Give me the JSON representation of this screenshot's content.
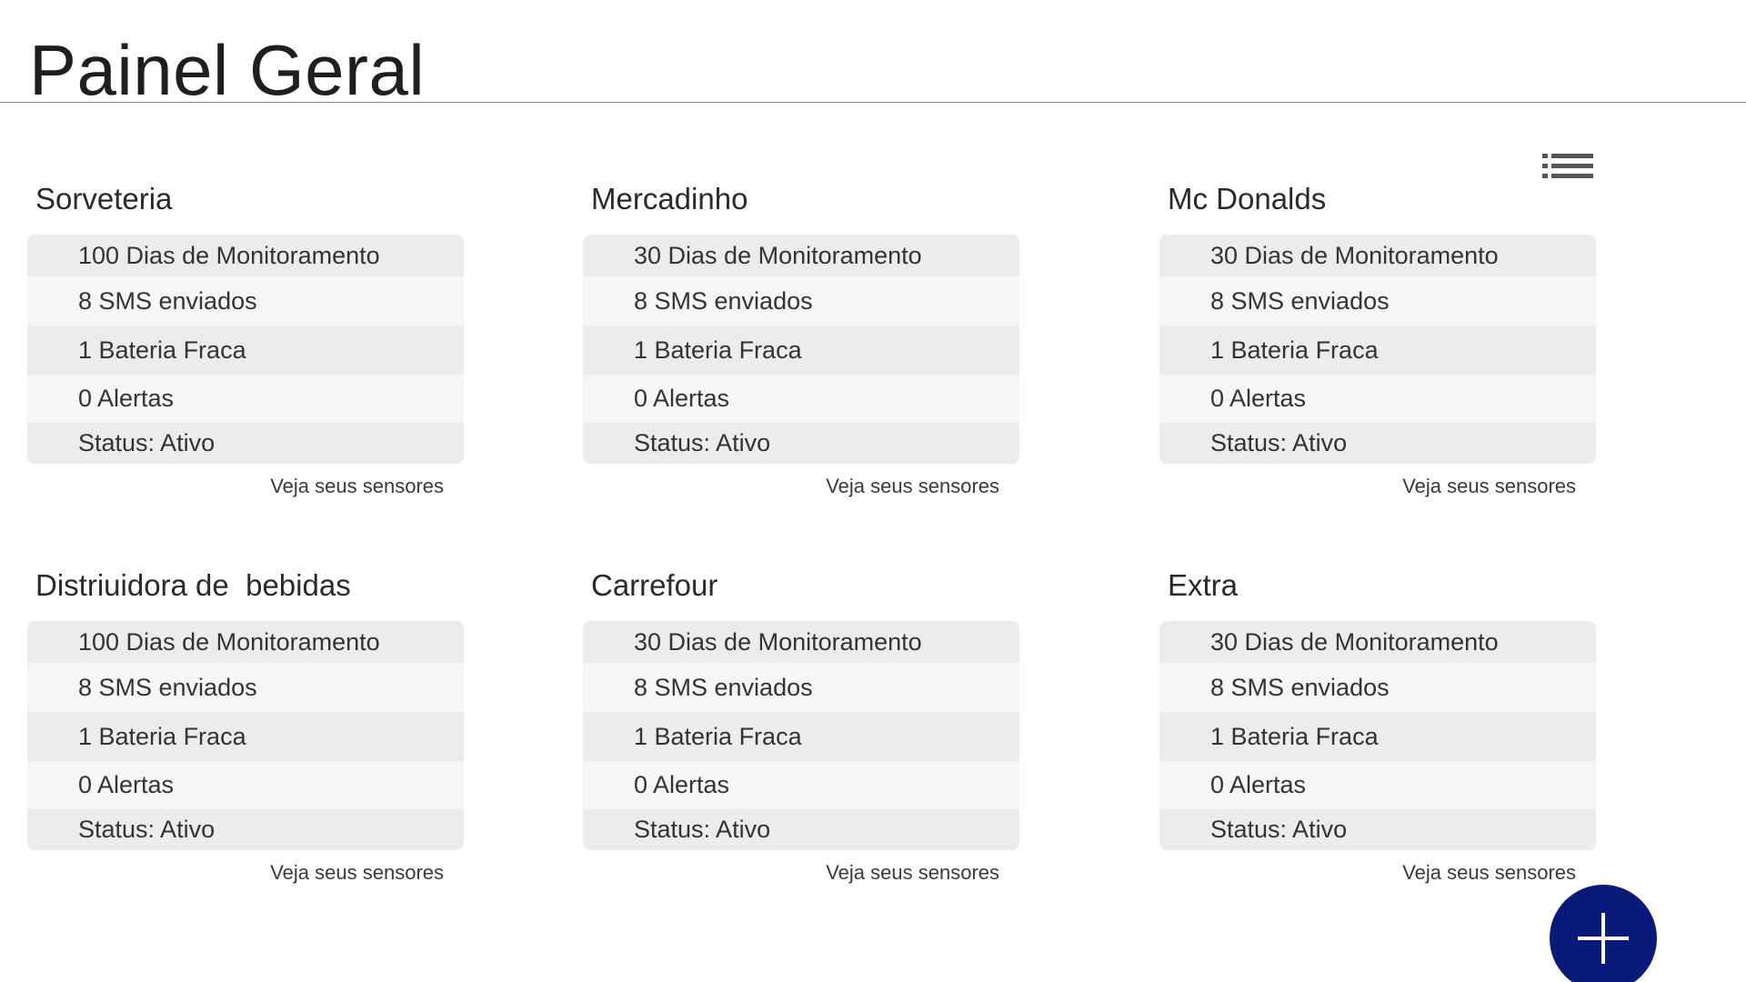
{
  "header": {
    "title": "Painel Geral",
    "menu_icon": "list-menu-icon"
  },
  "cards": [
    {
      "title": "Sorveteria",
      "stats": [
        "100 Dias de Monitoramento",
        "8 SMS enviados",
        "1 Bateria Fraca",
        "0 Alertas",
        "Status: Ativo"
      ],
      "link": "Veja seus sensores"
    },
    {
      "title": "Mercadinho",
      "stats": [
        "30 Dias de Monitoramento",
        "8 SMS enviados",
        "1 Bateria Fraca",
        "0 Alertas",
        "Status: Ativo"
      ],
      "link": "Veja seus sensores"
    },
    {
      "title": "Mc Donalds",
      "stats": [
        "30 Dias de Monitoramento",
        "8 SMS enviados",
        "1 Bateria Fraca",
        "0 Alertas",
        "Status: Ativo"
      ],
      "link": "Veja seus sensores"
    },
    {
      "title": "Distriuidora de  bebidas",
      "stats": [
        "100 Dias de Monitoramento",
        "8 SMS enviados",
        "1 Bateria Fraca",
        "0 Alertas",
        "Status: Ativo"
      ],
      "link": "Veja seus sensores"
    },
    {
      "title": "Carrefour",
      "stats": [
        "30 Dias de Monitoramento",
        "8 SMS enviados",
        "1 Bateria Fraca",
        "0 Alertas",
        "Status: Ativo"
      ],
      "link": "Veja seus sensores"
    },
    {
      "title": "Extra",
      "stats": [
        "30 Dias de Monitoramento",
        "8 SMS enviados",
        "1 Bateria Fraca",
        "0 Alertas",
        "Status: Ativo"
      ],
      "link": "Veja seus sensores"
    }
  ],
  "fab": {
    "icon": "plus-icon",
    "color": "#0a1a78"
  },
  "colors": {
    "row_dark": "#ececec",
    "row_light": "#f6f6f6",
    "title_text": "#1f1f1f"
  }
}
